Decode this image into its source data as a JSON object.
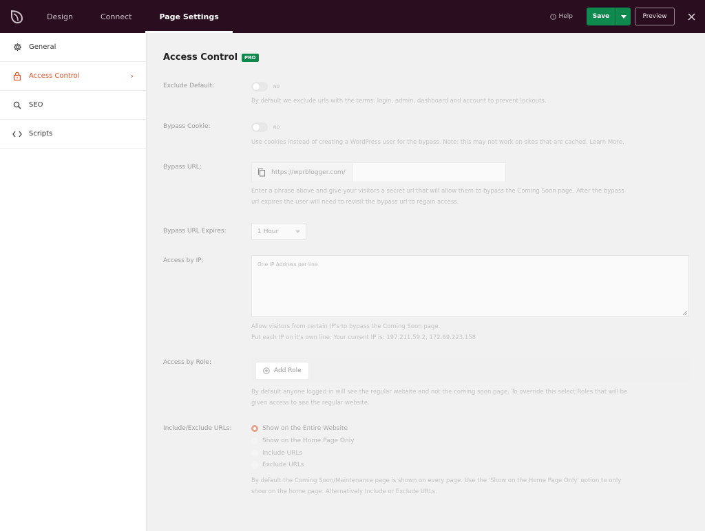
{
  "topbar": {
    "tabs": [
      "Design",
      "Connect",
      "Page Settings"
    ],
    "help_label": "Help",
    "save_label": "Save",
    "preview_label": "Preview"
  },
  "sidebar": {
    "items": [
      {
        "label": "General",
        "icon": "gear-icon"
      },
      {
        "label": "Access Control",
        "icon": "lock-icon"
      },
      {
        "label": "SEO",
        "icon": "search-icon"
      },
      {
        "label": "Scripts",
        "icon": "code-icon"
      }
    ]
  },
  "main": {
    "title": "Access Control",
    "pro_badge": "PRO",
    "exclude_default": {
      "label": "Exclude Default:",
      "toggle": "NO",
      "help": "By default we exclude urls with the terms: login, admin, dashboard and account to prevent lockouts."
    },
    "bypass_cookie": {
      "label": "Bypass Cookie:",
      "toggle": "NO",
      "help": "Use cookies instead of creating a WordPress user for the bypass. Note: this may not work on sites that are cached. Learn More."
    },
    "bypass_url": {
      "label": "Bypass URL:",
      "prefix": "https://wprblogger.com/",
      "value": "",
      "help1": "Enter a phrase above and give your visitors a secret url that will allow them to bypass the Coming Soon page. After the bypass",
      "help2": "url expires the user will need to revisit the bypass url to regain access."
    },
    "bypass_expires": {
      "label": "Bypass URL Expires:",
      "value": "1 Hour"
    },
    "access_ip": {
      "label": "Access by IP:",
      "placeholder": "One IP Address per line",
      "help1": "Allow visitors from certain IP's to bypass the Coming Soon page.",
      "help2": "Put each IP on it's own line. Your current IP is: 197.211.59.2, 172.69.223.158"
    },
    "access_role": {
      "label": "Access by Role:",
      "button": "Add Role",
      "help1": "By default anyone logged in will see the regular website and not the coming soon page. To override this select Roles that will be",
      "help2": "given access to see the regular website."
    },
    "include_exclude": {
      "label": "Include/Exclude URLs:",
      "options": [
        "Show on the Entire Website",
        "Show on the Home Page Only",
        "Include URLs",
        "Exclude URLs"
      ],
      "selected": 0,
      "help1": "By default the Coming Soon/Maintenance page is shown on every page. Use the 'Show on the Home Page Only' option to only",
      "help2": "show on the home page. Alternatively Include or Exclude URLs."
    }
  },
  "colors": {
    "topbar": "#2a0e1f",
    "accent": "#e1502b",
    "save": "#0f8a4f"
  }
}
